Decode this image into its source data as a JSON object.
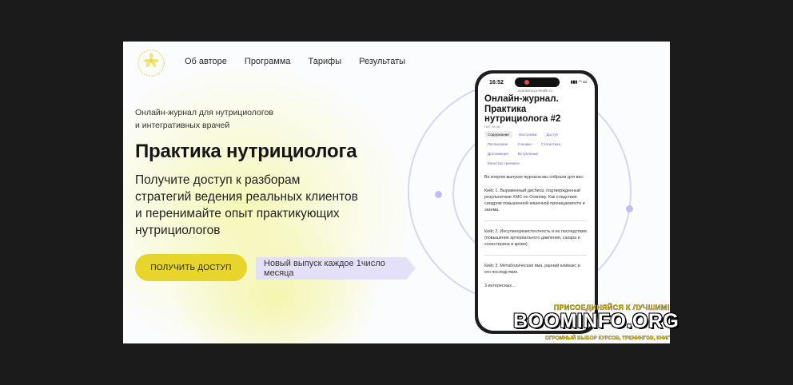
{
  "nav": {
    "items": [
      "Об авторе",
      "Программа",
      "Тарифы",
      "Результаты"
    ]
  },
  "hero": {
    "subtitle_line1": "Онлайн-журнал для нутрициологов",
    "subtitle_line2": "и интегративных врачей",
    "title": "Практика нутрициолога",
    "lead_line1": "Получите доступ к разборам",
    "lead_line2": "стратегий ведения реальных клиентов",
    "lead_line3": "и перенимайте опыт практикующих",
    "lead_line4": "нутрициологов",
    "cta": "ПОЛУЧИТЬ ДОСТУП",
    "badge": "Новый выпуск каждое 1число месяца"
  },
  "phone": {
    "time": "16:52",
    "status_icons": "▮▮▮ ◠ ▭",
    "url": "evdokimova-health.ru",
    "title_line1": "Онлайн-журнал.",
    "title_line2": "Практика",
    "title_line3": "нутрициолога #2",
    "date": "НИГ 18:08",
    "menu_row1": [
      "Содержание",
      "Настройки",
      "Доступ"
    ],
    "menu_row2": [
      "Расписание",
      "Ученики",
      "Статистика"
    ],
    "menu_row3": [
      "Достижения",
      "Вступление"
    ],
    "menu_row4": [
      "Качество тренинга"
    ],
    "intro": "Во втором выпуске журнала мы собрали для вас:",
    "case1": "Кейс 1. Выраженный дисбиоз, подтвержденный результатами ХМС по Осипову. Как следствие синдром повышенной кишечной проницаемости и экзема.",
    "case2": "Кейс 2. Инсулинорезистентность и ее последствия (повышение артериального давления, сахара и холестерина в крови).",
    "case3": "Кейс 3. Метаболическая яма, ранний климакс и его последствия.",
    "more": "3 интересных…"
  },
  "watermark": {
    "top": "ПРИСОЕДИНЯЙСЯ К ЛУЧШИМ!",
    "main": "BOOMINFO.ORG",
    "bottom": "ОГРОМНЫЙ ВЫБОР КУРСОВ, ТРЕНИНГОВ, КНИГ"
  },
  "colors": {
    "accent": "#e7d52c",
    "badge_bg": "#e4e0f8",
    "orbit": "#d8d5f3"
  }
}
